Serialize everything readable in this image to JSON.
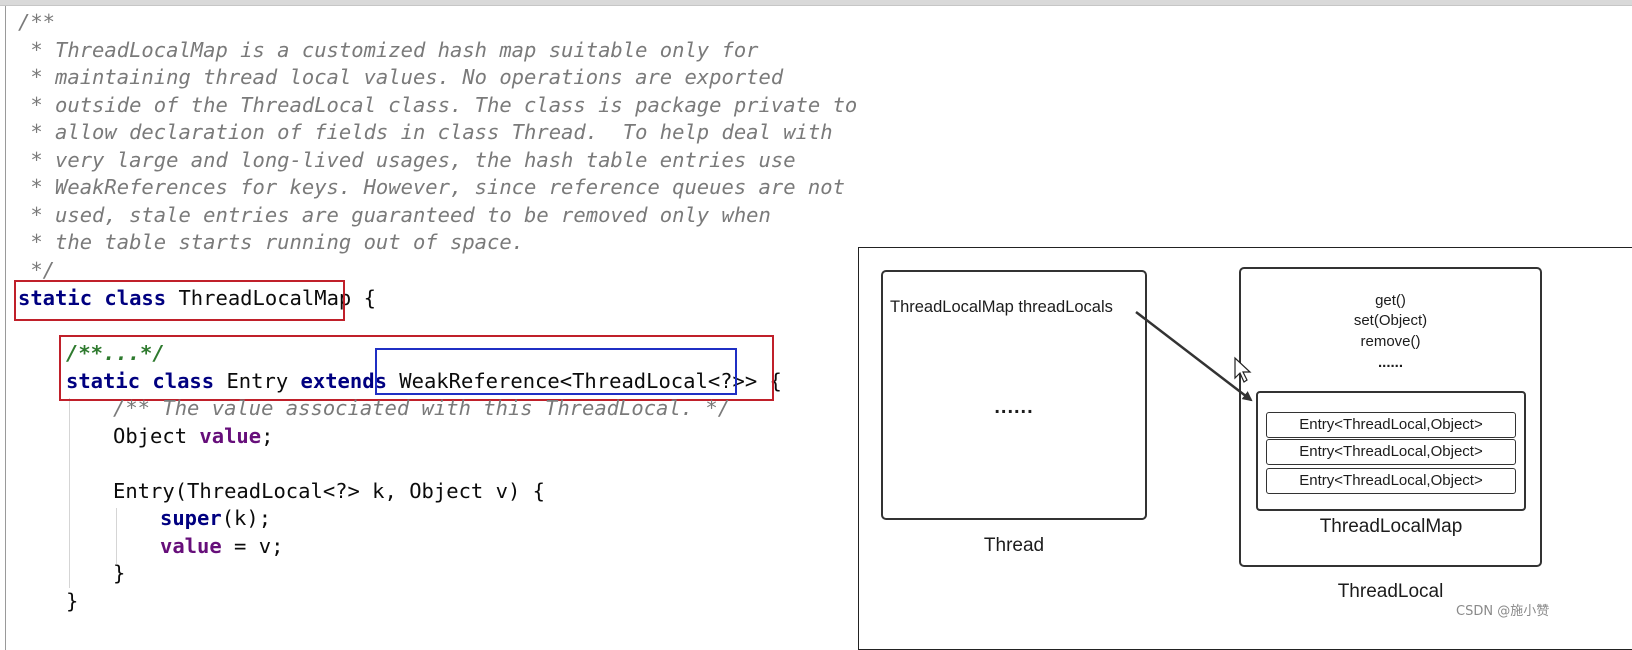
{
  "code": {
    "comment_lines": [
      "/**",
      " * ThreadLocalMap is a customized hash map suitable only for",
      " * maintaining thread local values. No operations are exported",
      " * outside of the ThreadLocal class. The class is package private to",
      " * allow declaration of fields in class Thread.  To help deal with",
      " * very large and long-lived usages, the hash table entries use",
      " * WeakReferences for keys. However, since reference queues are not",
      " * used, stale entries are guaranteed to be removed only when",
      " * the table starts running out of space.",
      " */"
    ],
    "kw_static": "static",
    "kw_class": "class",
    "kw_extends": "extends",
    "kw_super": "super",
    "map_class_name": "ThreadLocalMap",
    "open_brace": "{",
    "close_brace": "}",
    "folded_doc": "/**...*/",
    "entry_class_name": "Entry",
    "weak_ref_type": "WeakReference<ThreadLocal<?>>",
    "value_comment": "/** The value associated with this ThreadLocal. */",
    "object_type": "Object",
    "value_field": "value",
    "semicolon": ";",
    "ctor_signature": "Entry(ThreadLocal<?> k, Object v) {",
    "super_args": "(k);",
    "assign_rest": " = v;"
  },
  "diagram": {
    "thread_field": "ThreadLocalMap threadLocals",
    "thread_ellipsis": "......",
    "thread_label": "Thread",
    "methods": [
      "get()",
      "set(Object)",
      "remove()",
      "......"
    ],
    "entries": [
      "Entry<ThreadLocal,Object>",
      "Entry<ThreadLocal,Object>",
      "Entry<ThreadLocal,Object>"
    ],
    "map_label": "ThreadLocalMap",
    "threadlocal_label": "ThreadLocal"
  },
  "watermark": "CSDN @施小赞",
  "colors": {
    "keyword": "#000080",
    "field": "#660e7a",
    "comment": "#7a7a7a",
    "doc_folded": "#2e7a2e",
    "highlight_red": "#c0202a",
    "highlight_blue": "#1f2fc4"
  }
}
